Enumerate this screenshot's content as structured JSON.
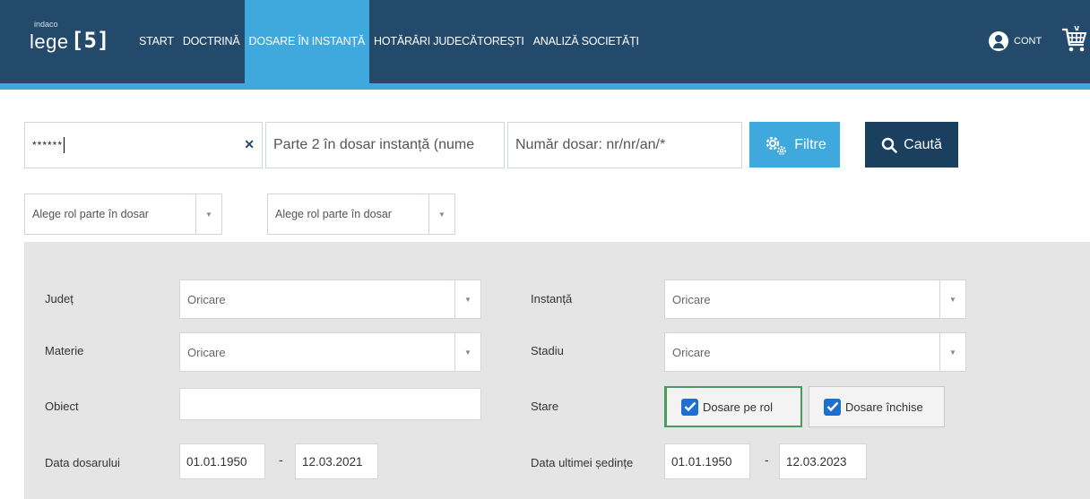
{
  "logo": {
    "small": "indaco",
    "brand": "lege",
    "number": "[5]"
  },
  "nav": [
    {
      "label": "START",
      "active": false
    },
    {
      "label": "DOCTRINĂ",
      "active": false
    },
    {
      "label": "DOSARE ÎN INSTANȚĂ",
      "active": true
    },
    {
      "label": "HOTĂRÂRI JUDECĂTOREȘTI",
      "active": false
    },
    {
      "label": "ANALIZĂ SOCIETĂȚI",
      "active": false
    }
  ],
  "account": {
    "label": "CONT",
    "icon": "user-circle-icon",
    "cart_icon": "cart-icon"
  },
  "search": {
    "party1_value": "******",
    "party2_placeholder": "Parte 2 în dosar instanță (nume",
    "case_number_placeholder": "Număr dosar: nr/nr/an/*",
    "filter_label": "Filtre",
    "search_label": "Caută"
  },
  "roles": {
    "role1": "Alege rol parte în dosar",
    "role2": "Alege rol parte în dosar"
  },
  "filters": {
    "county": {
      "label": "Județ",
      "value": "Oricare"
    },
    "subject": {
      "label": "Materie",
      "value": "Oricare"
    },
    "object": {
      "label": "Obiect",
      "value": ""
    },
    "case_date": {
      "label": "Data dosarului",
      "from": "01.01.1950",
      "to": "12.03.2021"
    },
    "court": {
      "label": "Instanță",
      "value": "Oricare"
    },
    "stage": {
      "label": "Stadiu",
      "value": "Oricare"
    },
    "status": {
      "label": "Stare",
      "open": "Dosare pe rol",
      "closed": "Dosare închise"
    },
    "last_hearing": {
      "label": "Data ultimei ședințe",
      "from": "01.01.1950",
      "to": "12.03.2023"
    },
    "dash": "-"
  },
  "colors": {
    "nav_bg": "#234a6b",
    "accent": "#3fa9dd",
    "search_btn": "#1a3f5f",
    "panel_bg": "#e5e5e5"
  }
}
